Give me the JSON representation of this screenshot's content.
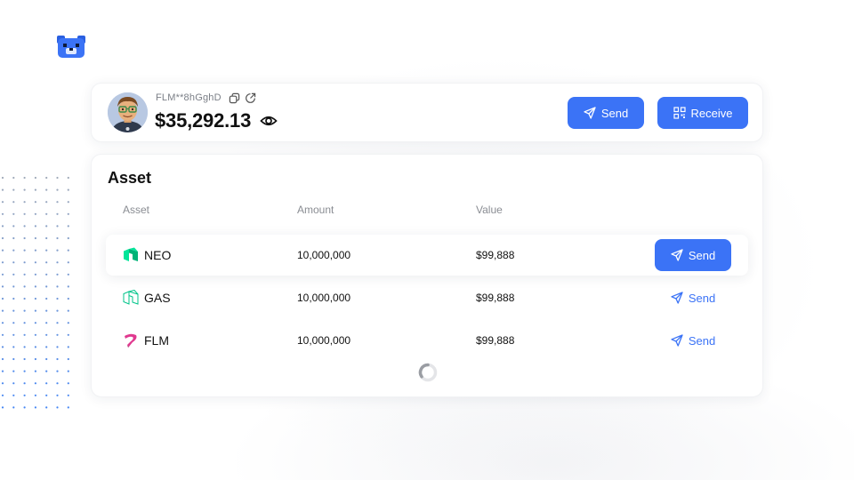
{
  "header": {
    "logo_icon": "bear-logo-icon"
  },
  "wallet": {
    "address": "FLM**8hGghD",
    "balance": "$35,292.13",
    "avatar_icon": "memoji-avatar",
    "copy_icon": "copy-icon",
    "external_icon": "external-link-icon",
    "visibility_icon": "eye-icon",
    "send_label": "Send",
    "receive_label": "Receive"
  },
  "assets": {
    "title": "Asset",
    "columns": {
      "asset": "Asset",
      "amount": "Amount",
      "value": "Value"
    },
    "rows": [
      {
        "name": "NEO",
        "amount": "10,000,000",
        "value": "$99,888",
        "send_label": "Send",
        "icon": "neo-icon",
        "highlighted": true
      },
      {
        "name": "GAS",
        "amount": "10,000,000",
        "value": "$99,888",
        "send_label": "Send",
        "icon": "gas-icon",
        "highlighted": false
      },
      {
        "name": "FLM",
        "amount": "10,000,000",
        "value": "$99,888",
        "send_label": "Send",
        "icon": "flm-icon",
        "highlighted": false
      }
    ]
  },
  "colors": {
    "accent": "#3b73f6",
    "neo_green": "#00e599",
    "flm_pink": "#e0398f",
    "text_primary": "#111111",
    "text_muted": "#8a8d93"
  }
}
